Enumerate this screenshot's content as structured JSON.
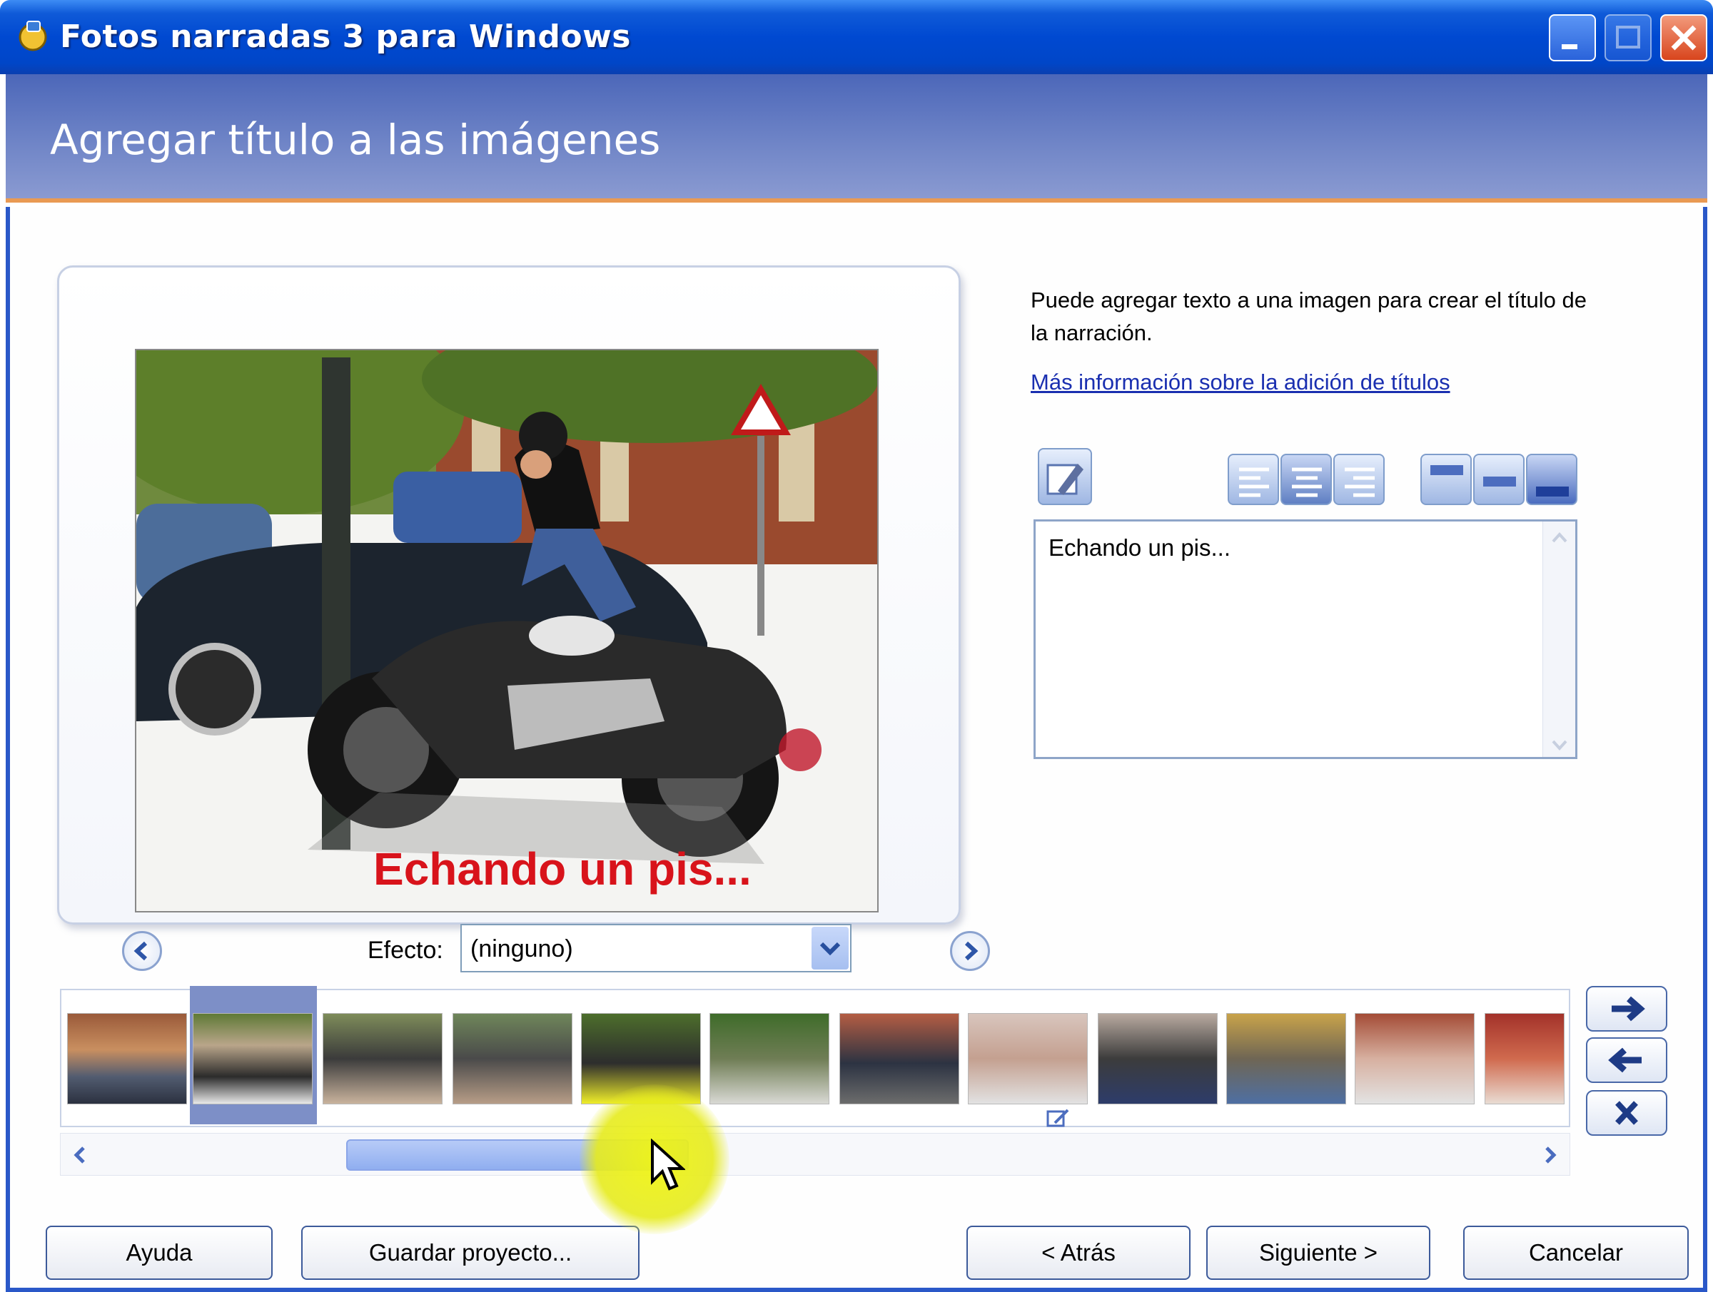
{
  "window": {
    "title": "Fotos narradas 3 para Windows",
    "controls": [
      "minimize",
      "maximize",
      "close"
    ]
  },
  "header": {
    "title": "Agregar título a las imágenes"
  },
  "preview": {
    "caption_overlay": "Echando un pis...",
    "effect_label": "Efecto:",
    "effect_value": "(ninguno)"
  },
  "info": {
    "description": "Puede agregar texto a una imagen para crear el título de la narración.",
    "link": "Más información sobre la adición de títulos"
  },
  "editor": {
    "caption_text": "Echando un pis..."
  },
  "filmstrip": {
    "thumbnails": 12,
    "selected_index": 1
  },
  "buttons": {
    "help": "Ayuda",
    "save_project": "Guardar proyecto...",
    "back": "< Atrás",
    "next": "Siguiente >",
    "cancel": "Cancelar"
  },
  "colors": {
    "titlebar": "#0049d1",
    "header": "#6a7fc4",
    "caption_red": "#d8131b",
    "link_blue": "#1a2fb0",
    "cursor_highlight": "#eef214"
  }
}
